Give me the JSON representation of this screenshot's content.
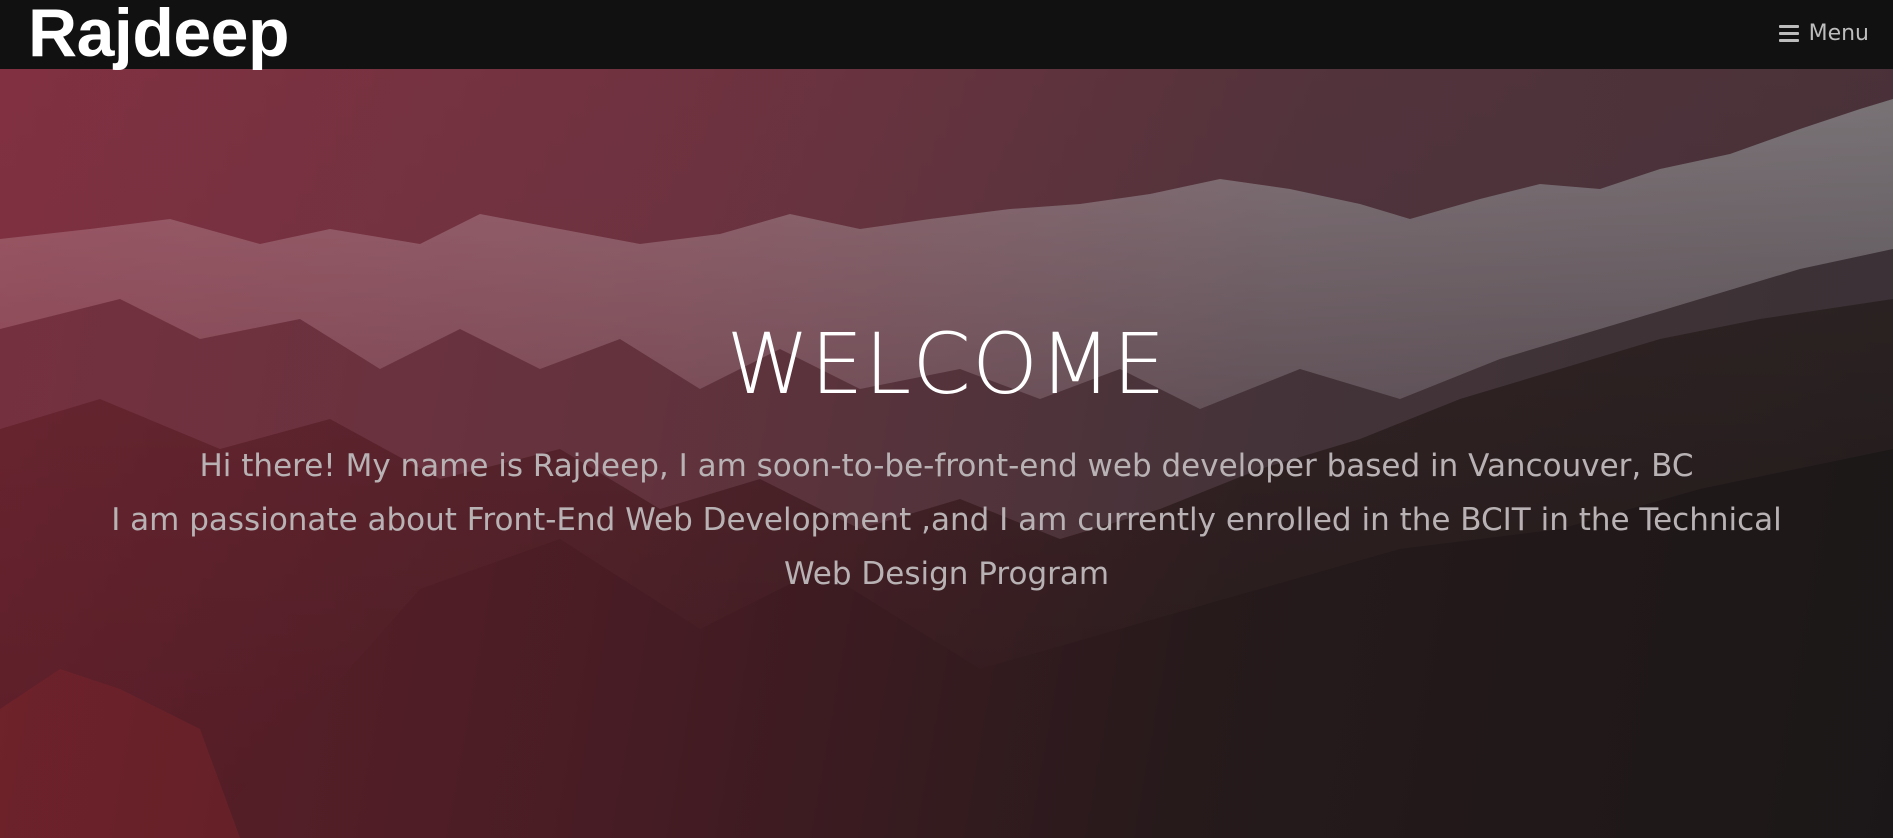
{
  "header": {
    "brand": "Rajdeep",
    "menu_label": "Menu",
    "menu_icon": "hamburger-icon"
  },
  "hero": {
    "heading": "WELCOME",
    "line1": "Hi there! My name is Rajdeep, I am soon-to-be-front-end web developer based in Vancouver, BC",
    "line2": "I am passionate about Front-End Web Development ,and I am currently enrolled in the BCIT in the Technical Web Design Program",
    "background": "mountain-landscape-photo"
  },
  "colors": {
    "nav_bg": "#111111",
    "overlay_accent": "#c82d4b",
    "heading_text": "#ffffff",
    "body_text": "#b8b2b4"
  }
}
